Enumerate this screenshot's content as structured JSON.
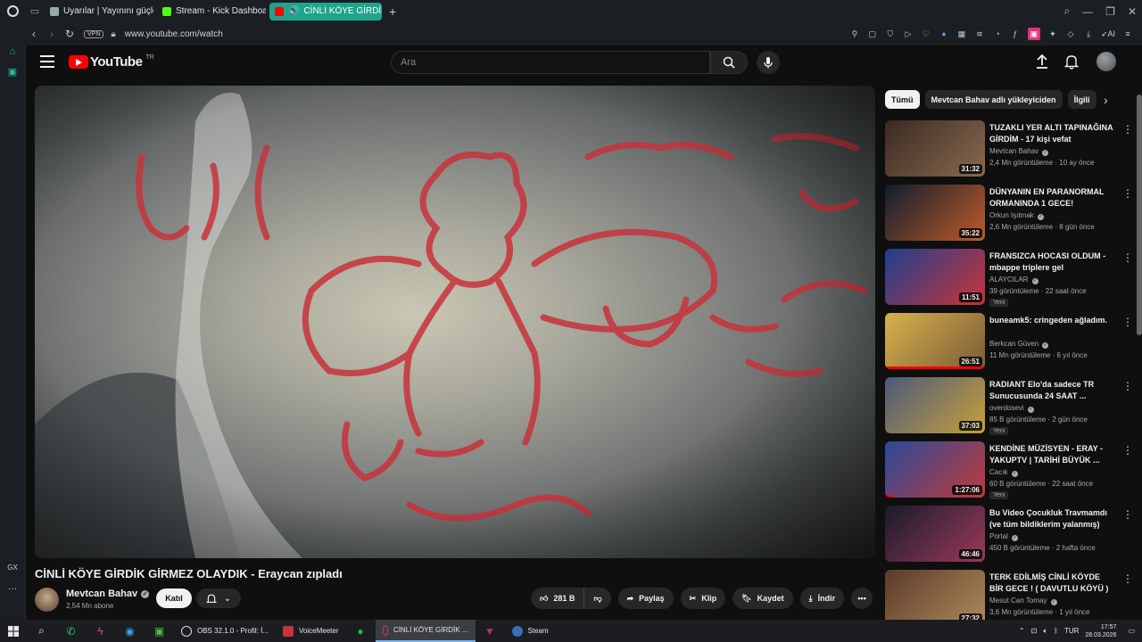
{
  "browser": {
    "tabs": [
      {
        "label": "Uyarılar | Yayınını güçlend",
        "active": false
      },
      {
        "label": "Stream - Kick Dashboard",
        "active": false
      },
      {
        "label": "CİNLİ KÖYE GİRDİK Gİ",
        "active": true
      }
    ],
    "url": "www.youtube.com/watch",
    "vpn_label": "VPN",
    "ai_label": "AI",
    "sidebar_bottom": [
      "GX",
      "…"
    ]
  },
  "youtube": {
    "logo_text": "YouTube",
    "region": "TR",
    "search_placeholder": "Ara",
    "video": {
      "title": "CİNLİ KÖYE GİRDİK GİRMEZ OLAYDIK - Eraycan zıpladı",
      "channel": "Mevtcan Bahav",
      "subscribers": "2,54 Mn abone",
      "join_label": "Katıl",
      "likes": "281 B",
      "share_label": "Paylaş",
      "clip_label": "Klip",
      "save_label": "Kaydet",
      "download_label": "İndir"
    },
    "chips": [
      "Tümü",
      "Mevtcan Bahav adlı yükleyiciden",
      "İlgili"
    ],
    "recommendations": [
      {
        "title": "TUZAKLI YER ALTI TAPINAĞINA GİRDİM - 17 kişi vefat",
        "channel": "Mevtcan Bahav",
        "views": "2,4 Mn görüntüleme",
        "age": "10 ay önce",
        "duration": "31:32",
        "badge": "",
        "progress": 0,
        "colors": [
          "#3a2a22",
          "#8a6a50"
        ]
      },
      {
        "title": "DÜNYANIN EN PARANORMAL ORMANINDA 1 GECE!",
        "channel": "Orkun Işıtmak",
        "views": "2,6 Mn görüntüleme",
        "age": "8 gün önce",
        "duration": "35:22",
        "badge": "",
        "progress": 0,
        "colors": [
          "#0e1e2e",
          "#c05a2a"
        ]
      },
      {
        "title": "FRANSIZCA HOCASI OLDUM - mbappe triplere gel",
        "channel": "ALAYCILAR",
        "views": "39 görüntüleme",
        "age": "22 saat önce",
        "duration": "11:51",
        "badge": "Yeni",
        "progress": 0,
        "colors": [
          "#1f3f8f",
          "#c8343a"
        ]
      },
      {
        "title": "buneamk5: cringeden ağladım.",
        "channel": "Berkcan Güven",
        "views": "11 Mn görüntüleme",
        "age": "6 yıl önce",
        "duration": "26:51",
        "badge": "",
        "progress": 100,
        "colors": [
          "#d8b24a",
          "#7a5a3a"
        ]
      },
      {
        "title": "RADIANT Elo'da sadece TR Sunucusunda 24 SAAT ...",
        "channel": "overdosevi",
        "views": "85 B görüntüleme",
        "age": "2 gün önce",
        "duration": "37:03",
        "badge": "Yeni",
        "progress": 0,
        "colors": [
          "#4a5a7a",
          "#c8a03a"
        ]
      },
      {
        "title": "KENDİNE MÜZİSYEN - ERAY - YAKUPTV | TARİHİ BÜYÜK ...",
        "channel": "Cacık",
        "views": "60 B görüntüleme",
        "age": "22 saat önce",
        "duration": "1:27:06",
        "badge": "Yeni",
        "progress": 8,
        "colors": [
          "#2a4a9a",
          "#c03a3a"
        ]
      },
      {
        "title": "Bu Video Çocukluk Travmamdı (ve tüm bildiklerim yalanmış)",
        "channel": "Portal",
        "views": "450 B görüntüleme",
        "age": "2 hafta önce",
        "duration": "46:46",
        "badge": "",
        "progress": 0,
        "colors": [
          "#1a1a2a",
          "#9a3a5a"
        ]
      },
      {
        "title": "TERK EDİLMİŞ CİNLİ KÖYDE BİR GECE ! ( DAVUTLU KÖYÜ ) w/ ...",
        "channel": "Mesut Can Tomay",
        "views": "3,6 Mn görüntüleme",
        "age": "1 yıl önce",
        "duration": "27:32",
        "badge": "",
        "progress": 0,
        "colors": [
          "#5a3a2a",
          "#b08a5a"
        ]
      }
    ]
  },
  "taskbar": {
    "apps": [
      {
        "label": "OBS 32.1.0 - Profil: İ...",
        "active": false
      },
      {
        "label": "VoiceMeeter",
        "active": false
      },
      {
        "label": "CİNLİ KÖYE GİRDİK ...",
        "active": true
      },
      {
        "label": "Steam",
        "active": false
      }
    ],
    "lang": "TUR",
    "time": "17:57",
    "date": "28.03.2026"
  }
}
